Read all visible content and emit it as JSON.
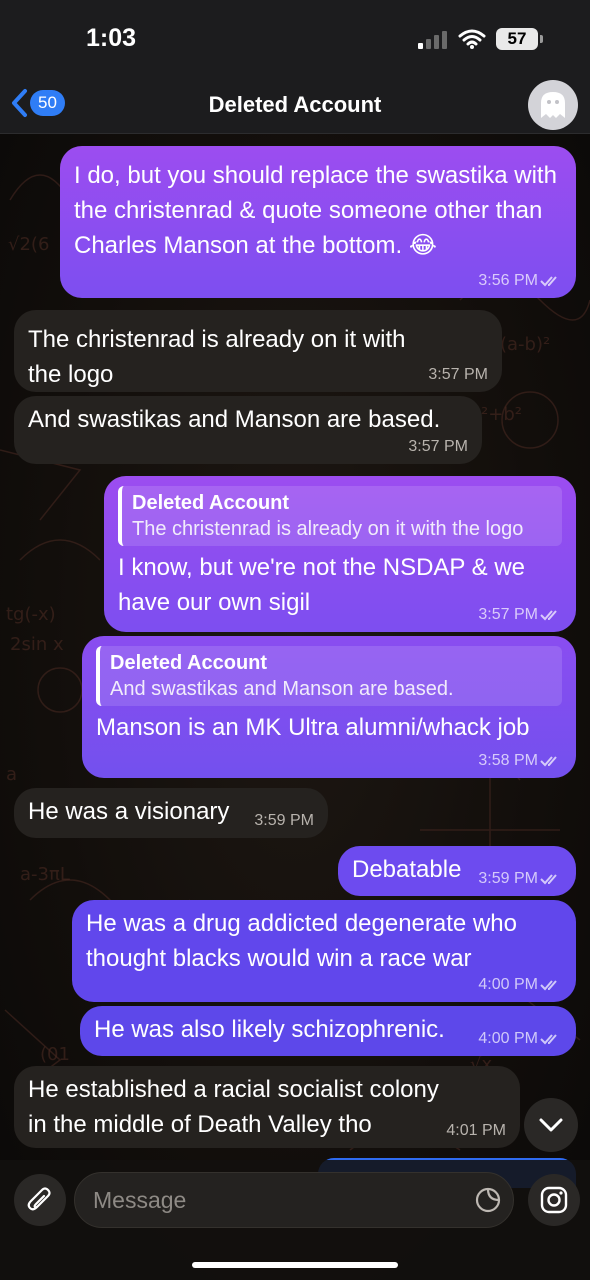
{
  "status_bar": {
    "time": "1:03",
    "battery": "57"
  },
  "nav": {
    "unread_count": "50",
    "title": "Deleted Account"
  },
  "messages": [
    {
      "direction": "out",
      "text": "I do, but you should replace the swastika with the christenrad & quote someone other than Charles Manson at the bottom. 😂",
      "time": "3:56 PM"
    },
    {
      "direction": "in",
      "text": "The christenrad is already on it with the logo",
      "time": "3:57 PM"
    },
    {
      "direction": "in",
      "text": "And swastikas and Manson are based.",
      "time": "3:57 PM"
    },
    {
      "direction": "out",
      "reply_name": "Deleted Account",
      "reply_text": "The christenrad is already on it with the logo",
      "text": "I know, but we're not the NSDAP & we have our own sigil",
      "time": "3:57 PM"
    },
    {
      "direction": "out",
      "reply_name": "Deleted Account",
      "reply_text": "And swastikas and Manson are based.",
      "text": "Manson is an MK Ultra alumni/whack job",
      "time": "3:58 PM"
    },
    {
      "direction": "in",
      "text": "He was a visionary",
      "time": "3:59 PM"
    },
    {
      "direction": "out",
      "text": "Debatable",
      "time": "3:59 PM"
    },
    {
      "direction": "out",
      "text": "He was a drug addicted degenerate who thought blacks would win a race war",
      "time": "4:00 PM"
    },
    {
      "direction": "out",
      "text": "He was also likely schizophrenic.",
      "time": "4:00 PM"
    },
    {
      "direction": "in",
      "text": "He established a racial socialist colony in the middle of Death Valley tho",
      "time": "4:01 PM"
    }
  ],
  "composer": {
    "placeholder": "Message"
  },
  "icons": {
    "back": "chevron-left-icon",
    "avatar": "ghost-icon",
    "read_receipt": "double-check-icon",
    "scroll": "chevron-down-icon",
    "attach": "paperclip-icon",
    "sticker": "sticker-icon",
    "camera": "instagram-camera-icon"
  },
  "colors": {
    "accent": "#2f7df6",
    "outgoing_top": "#9c4df0",
    "outgoing_bottom": "#6147ec",
    "incoming": "#25221f"
  }
}
